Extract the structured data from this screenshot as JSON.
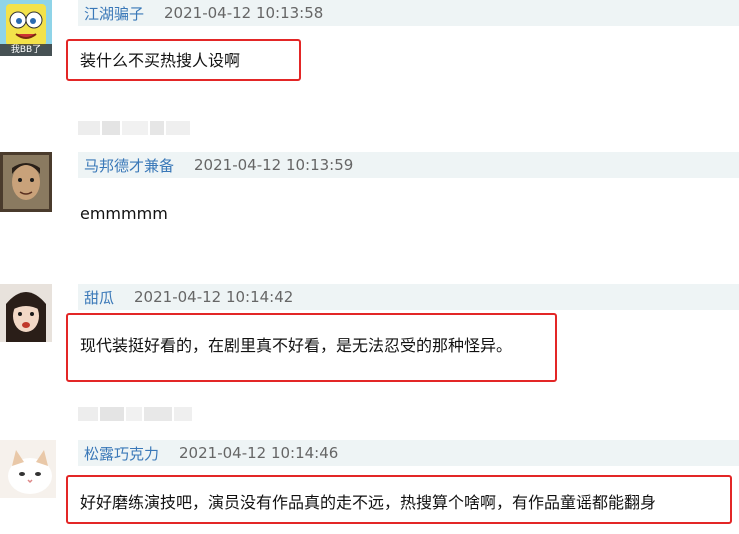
{
  "comments": [
    {
      "username": "江湖骗子",
      "timestamp": "2021-04-12 10:13:58",
      "text": "装什么不买热搜人设啊",
      "highlighted": true,
      "avatar_badge": "我BB了"
    },
    {
      "username": "马邦德才兼备",
      "timestamp": "2021-04-12 10:13:59",
      "text": "emmmmm",
      "highlighted": false
    },
    {
      "username": "甜瓜",
      "timestamp": "2021-04-12 10:14:42",
      "text": "现代装挺好看的，在剧里真不好看，是无法忍受的那种怪异。",
      "highlighted": true
    },
    {
      "username": "松露巧克力",
      "timestamp": "2021-04-12 10:14:46",
      "text": "好好磨练演技吧，演员没有作品真的走不远，热搜算个啥啊，有作品童谣都能翻身",
      "highlighted": true
    }
  ],
  "colors": {
    "username": "#3a78b8",
    "timestamp": "#666666",
    "header_bg": "#eef4f5",
    "highlight_border": "#e32626"
  }
}
